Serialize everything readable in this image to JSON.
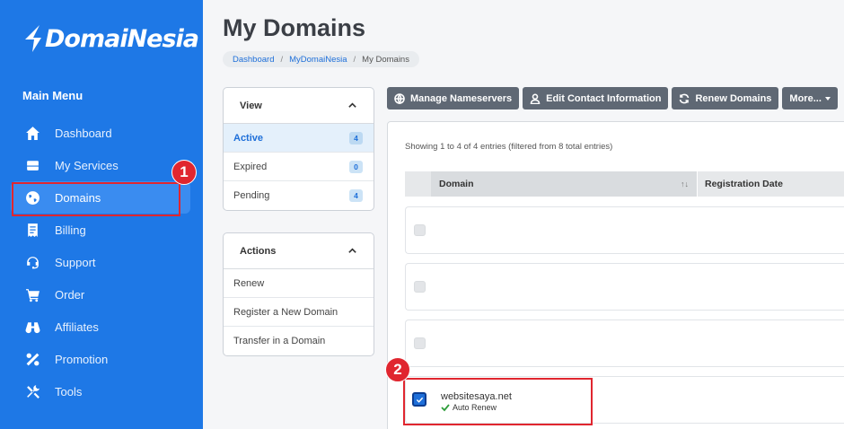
{
  "app": {
    "logo_text": "DomaiNesia"
  },
  "sidebar": {
    "title": "Main Menu",
    "items": [
      {
        "label": "Dashboard",
        "icon": "home-icon"
      },
      {
        "label": "My Services",
        "icon": "server-icon"
      },
      {
        "label": "Domains",
        "icon": "globe-icon",
        "active": true
      },
      {
        "label": "Billing",
        "icon": "receipt-icon"
      },
      {
        "label": "Support",
        "icon": "headset-icon"
      },
      {
        "label": "Order",
        "icon": "cart-icon"
      },
      {
        "label": "Affiliates",
        "icon": "binoculars-icon"
      },
      {
        "label": "Promotion",
        "icon": "percent-icon"
      },
      {
        "label": "Tools",
        "icon": "tools-icon"
      }
    ]
  },
  "annotations": {
    "step1": "1",
    "step2": "2"
  },
  "header": {
    "title": "My Domains",
    "breadcrumb": [
      "Dashboard",
      "MyDomaiNesia",
      "My Domains"
    ]
  },
  "view_panel": {
    "title": "View",
    "rows": [
      {
        "label": "Active",
        "count": "4",
        "active": true
      },
      {
        "label": "Expired",
        "count": "0"
      },
      {
        "label": "Pending",
        "count": "4"
      }
    ]
  },
  "actions_panel": {
    "title": "Actions",
    "rows": [
      "Renew",
      "Register a New Domain",
      "Transfer in a Domain"
    ]
  },
  "toolbar": {
    "manage_nameservers": "Manage Nameservers",
    "edit_contact": "Edit Contact Information",
    "renew_domains": "Renew Domains",
    "more": "More..."
  },
  "table": {
    "entries_text": "Showing 1 to 4 of 4 entries (filtered from 8 total entries)",
    "columns": [
      "Domain",
      "Registration Date"
    ],
    "sort_glyph": "↑↓",
    "rows": [
      {
        "domain": "",
        "status": "",
        "checked": false
      },
      {
        "domain": "",
        "status": "",
        "checked": false
      },
      {
        "domain": "",
        "status": "",
        "checked": false
      },
      {
        "domain": "websitesaya.net",
        "status": "Auto Renew",
        "checked": true
      }
    ]
  },
  "colors": {
    "sidebar_bg": "#1e78e6",
    "accent": "#1e6fd9",
    "highlight": "#e0262f",
    "toolbar_btn": "#5f6874"
  }
}
